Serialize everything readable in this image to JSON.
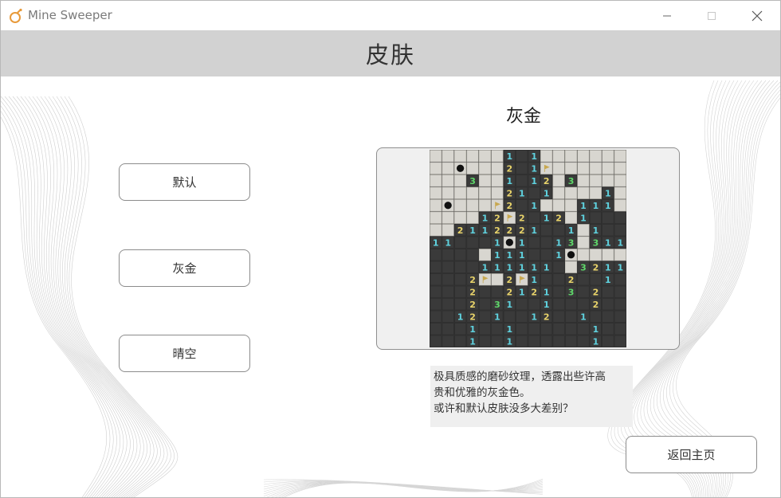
{
  "window": {
    "title": "Mine Sweeper",
    "controls": {
      "minimize": "minimize",
      "maximize": "maximize",
      "close": "close"
    }
  },
  "header": {
    "title": "皮肤"
  },
  "skins": [
    {
      "label": "默认"
    },
    {
      "label": "灰金"
    },
    {
      "label": "晴空"
    }
  ],
  "preview": {
    "skin_name": "灰金",
    "description_lines": [
      "极具质感的磨砂纹理，透露出些许高",
      "贵和优雅的灰金色。",
      "或许和默认皮肤没多大差别？"
    ],
    "board_rows": [
      "......1d1.......",
      "..m...2d1f......",
      "...3..1d12.3....",
      "......21d1....1.",
      ".m...f2d1...111.",
      "....12f2d12.1ddd",
      "..2112221dd1.1dd",
      "11ddd1m1dd13.311",
      "dddd.111dd1m....",
      "dddd111111d.3211",
      "ddd2f.2f1dd2dd1d",
      "ddd2dd2121d3d2dd",
      "ddd2d31dd1ddd2dd",
      "dd12d1dd12dd1ddd",
      "ddd1dd1dddddd1dd",
      "ddd1dd1dddddd1dd"
    ]
  },
  "actions": {
    "back_label": "返回主页"
  },
  "colors": {
    "header_band": "#d2d2d2",
    "cell_revealed": "#3a3a3a",
    "cell_hidden": "#d8d6d0",
    "number_1": "#5fd3e0",
    "number_2": "#e8d36a",
    "number_3": "#5fd86a",
    "flag": "#c8a850"
  }
}
